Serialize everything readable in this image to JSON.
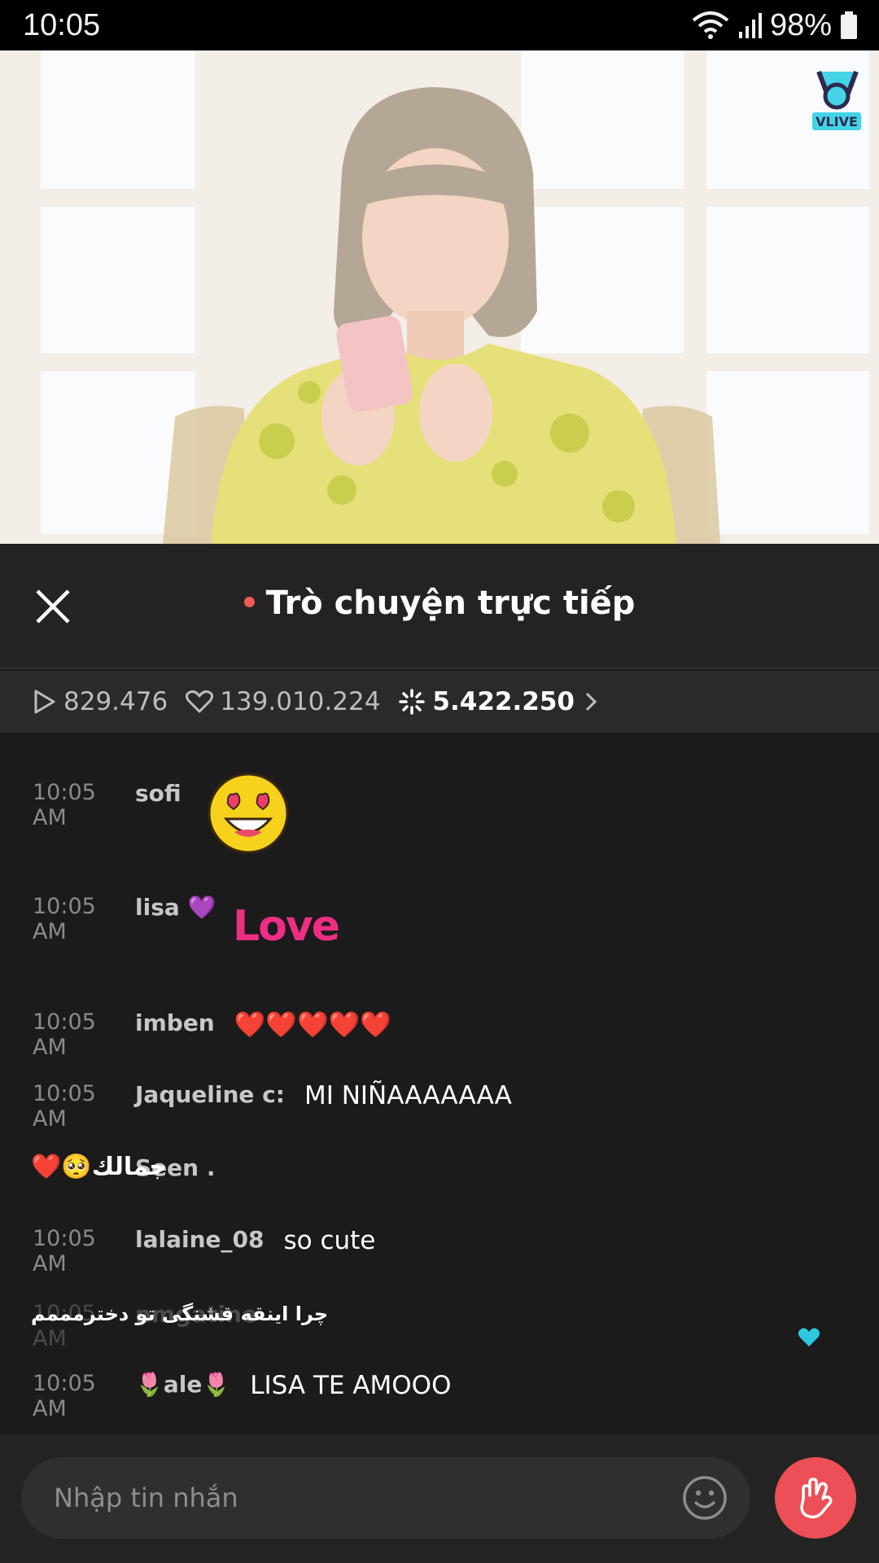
{
  "status_bar": {
    "time": "10:05",
    "battery": "98%"
  },
  "video": {
    "logo_text": "VLIVE"
  },
  "chat_header": {
    "title": "Trò chuyện trực tiếp"
  },
  "stats": {
    "plays": "829.476",
    "likes": "139.010.224",
    "cheers": "5.422.250"
  },
  "messages": [
    {
      "time": "10:05 AM",
      "user": "sofi",
      "text": "",
      "sticker": "heart-eyes-emoji-sticker"
    },
    {
      "time": "10:05 AM",
      "user": "lisa 💜",
      "text": "",
      "sticker": "love-sticker",
      "sticker_text": "Love"
    },
    {
      "time": "10:05 AM",
      "user": "imben",
      "text": "❤️❤️❤️❤️❤️"
    },
    {
      "time": "10:05 AM",
      "user": "Jaqueline c:",
      "text": "MI NIÑAAAAAAA"
    },
    {
      "time": "",
      "user": "Seen .",
      "text": "",
      "overlay": "❤️🥺جمالك"
    },
    {
      "time": "10:05 AM",
      "user": "lalaine_08",
      "text": "so cute"
    },
    {
      "time": "10:05 AM",
      "user": "nmgatine",
      "text": "",
      "overlay": "چرا اینقه قشنگی تو دخترمممم"
    },
    {
      "time": "10:05 AM",
      "user": "🌷ale🌷",
      "text": "LISA TE AMOOO"
    }
  ],
  "input": {
    "placeholder": "Nhập tin nhắn"
  },
  "colors": {
    "accent": "#ec4f55",
    "live_dot": "#f25a5a",
    "floating_heart": "#2bc8e0"
  }
}
